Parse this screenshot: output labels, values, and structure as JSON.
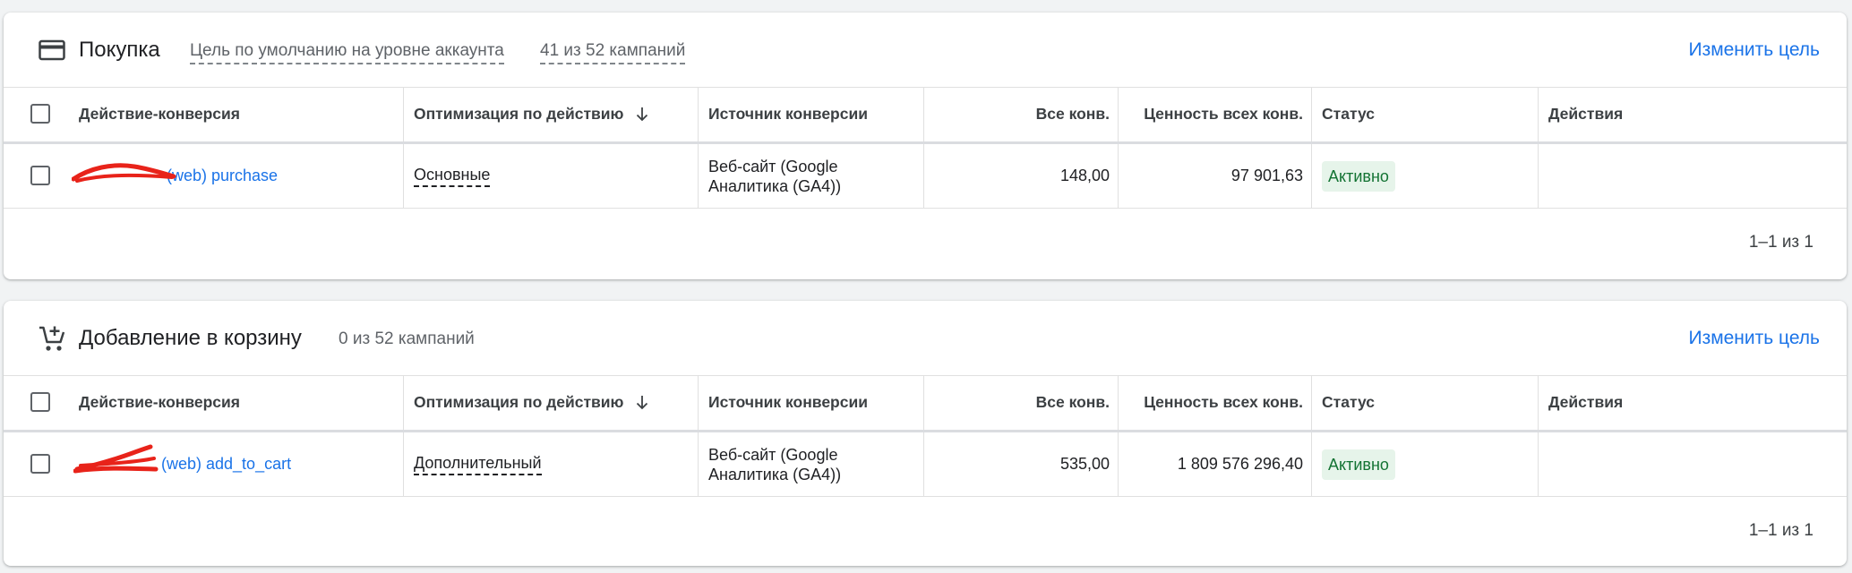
{
  "sections": [
    {
      "title": "Покупка",
      "meta1": "Цель по умолчанию на уровне аккаунта",
      "meta2": "41 из 52 кампаний",
      "link": "Изменить цель",
      "columns": {
        "action": "Действие-конверсия",
        "optimization": "Оптимизация по действию",
        "source": "Источник конверсии",
        "all_conv": "Все конв.",
        "all_value": "Ценность всех конв.",
        "status": "Статус",
        "actions": "Действия"
      },
      "rows": [
        {
          "action": "(web) purchase",
          "optimization": "Основные",
          "source": "Веб-сайт (Google Аналитика (GA4))",
          "all_conv": "148,00",
          "all_value": "97 901,63",
          "status": "Активно"
        }
      ],
      "pager": "1–1 из 1"
    },
    {
      "title": "Добавление в корзину",
      "meta1": "0 из 52 кампаний",
      "link": "Изменить цель",
      "columns": {
        "action": "Действие-конверсия",
        "optimization": "Оптимизация по действию",
        "source": "Источник конверсии",
        "all_conv": "Все конв.",
        "all_value": "Ценность всех конв.",
        "status": "Статус",
        "actions": "Действия"
      },
      "rows": [
        {
          "action": "(web) add_to_cart",
          "optimization": "Дополнительный",
          "source": "Веб-сайт (Google Аналитика (GA4))",
          "all_conv": "535,00",
          "all_value": "1 809 576 296,40",
          "status": "Активно"
        }
      ],
      "pager": "1–1 из 1"
    }
  ],
  "icons": {
    "section1": "credit-card-icon",
    "section2": "add-shopping-cart-icon",
    "sort": "arrow-downward-icon"
  },
  "colors": {
    "link": "#1a73e8",
    "status_bg": "#e6f4ea",
    "status_text": "#137333",
    "redaction": "#e8231a"
  }
}
